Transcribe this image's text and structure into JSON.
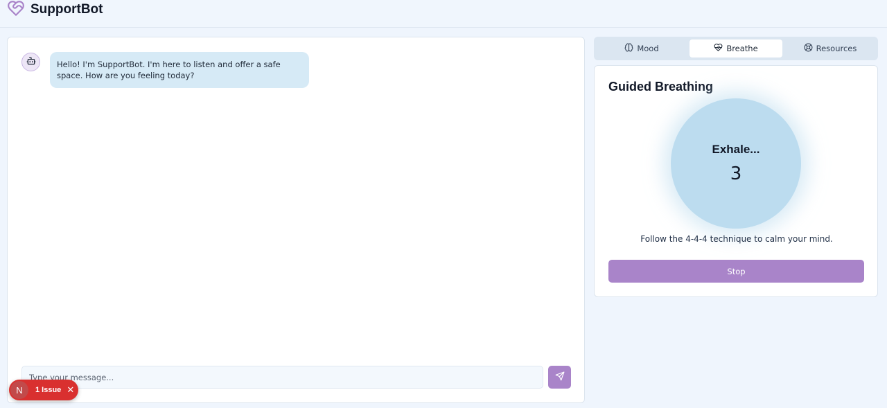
{
  "app": {
    "title": "SupportBot",
    "brand_icon": "heart-handshake-icon"
  },
  "chat": {
    "bot_icon": "bot-icon",
    "messages": [
      {
        "sender": "bot",
        "text": "Hello! I'm SupportBot. I'm here to listen and offer a safe space. How are you feeling today?"
      }
    ],
    "input": {
      "placeholder": "Type your message...",
      "value": ""
    },
    "send_icon": "send-icon"
  },
  "tabs": [
    {
      "label": "Mood",
      "icon": "brain-icon",
      "active": false
    },
    {
      "label": "Breathe",
      "icon": "heart-pulse-icon",
      "active": true
    },
    {
      "label": "Resources",
      "icon": "life-buoy-icon",
      "active": false
    }
  ],
  "breathing": {
    "title": "Guided Breathing",
    "phase": "Exhale...",
    "count": "3",
    "hint": "Follow the 4-4-4 technique to calm your mind.",
    "stop_label": "Stop"
  },
  "dev_overlay": {
    "badge": "N",
    "label": "1 Issue",
    "close": "✕"
  },
  "colors": {
    "accent": "#a984c9",
    "bubble": "#d6eaf6",
    "circle": "#bcdcef",
    "issue": "#d9302f",
    "background": "#eff5fd"
  }
}
